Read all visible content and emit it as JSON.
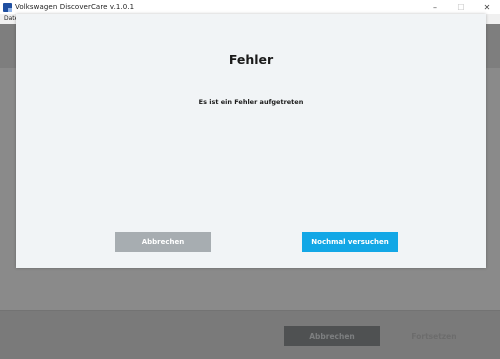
{
  "window": {
    "title": "Volkswagen DiscoverCare v.1.0.1",
    "icon": "vw-app-icon",
    "controls": {
      "minimize": "–",
      "maximize": "☐",
      "close": "✕"
    }
  },
  "menubar": {
    "items": [
      {
        "label": "Datei"
      }
    ]
  },
  "background": {
    "cancel_label": "Abbrechen",
    "next_label": "Fortsetzen"
  },
  "dialog": {
    "title": "Fehler",
    "message": "Es ist ein Fehler aufgetreten",
    "cancel_label": "Abbrechen",
    "retry_label": "Nochmal versuchen"
  },
  "colors": {
    "primary_button": "#12a7e6",
    "secondary_button": "#a7adb1",
    "dialog_bg": "#f1f4f6",
    "overlay": "#8a8a8a"
  }
}
